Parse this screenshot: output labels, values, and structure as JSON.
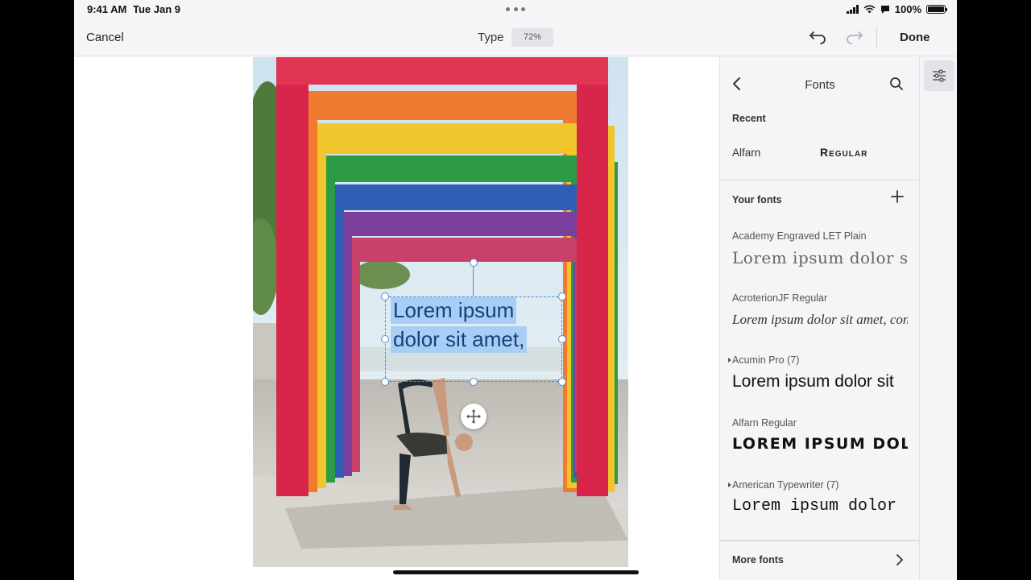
{
  "status_bar": {
    "time": "9:41 AM",
    "date": "Tue Jan 9",
    "battery": "100%"
  },
  "toolbar": {
    "cancel": "Cancel",
    "mode": "Type",
    "zoom": "72%",
    "done": "Done"
  },
  "canvas": {
    "text_line1": "Lorem ipsum",
    "text_line2": "dolor sit amet,"
  },
  "panel": {
    "title": "Fonts",
    "recent_label": "Recent",
    "recent": {
      "name": "Alfarn",
      "style": "Regular"
    },
    "your_fonts_label": "Your fonts",
    "fonts": [
      {
        "name": "Academy Engraved LET Plain",
        "sample": "Lorem ipsum dolor sit",
        "expandable": false
      },
      {
        "name": "AcroterionJF Regular",
        "sample": "Lorem ipsum dolor sit amet, conse",
        "expandable": false
      },
      {
        "name": "Acumin Pro (7)",
        "sample": "Lorem ipsum dolor sit",
        "expandable": true
      },
      {
        "name": "Alfarn Regular",
        "sample": "Lorem ipsum dolor",
        "expandable": false
      },
      {
        "name": "American Typewriter (7)",
        "sample": "Lorem ipsum dolor s",
        "expandable": true
      }
    ],
    "more_fonts": "More fonts"
  },
  "colors": {
    "selection": "#a9cef6",
    "text": "#15407c",
    "handle": "#4d8fd1"
  },
  "icons": [
    "back-chevron-icon",
    "search-icon",
    "plus-icon",
    "chevron-right-icon",
    "undo-icon",
    "redo-icon",
    "sliders-icon",
    "move-icon"
  ]
}
